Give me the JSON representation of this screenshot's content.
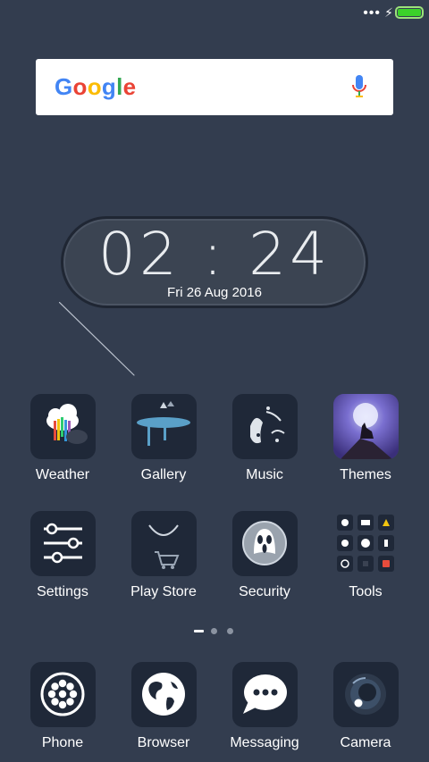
{
  "status_bar": {
    "dots": "•••",
    "charging_icon": "lightning-bolt",
    "battery_level": 1.0,
    "battery_color": "#3bd12a"
  },
  "search": {
    "logo": [
      "G",
      "o",
      "o",
      "g",
      "l",
      "e"
    ],
    "logo_colors": [
      "#4285f4",
      "#ea4335",
      "#fbbc05",
      "#4285f4",
      "#34a853",
      "#ea4335"
    ],
    "mic_icon": "mic"
  },
  "clock": {
    "time": "02 : 24",
    "date": "Fri 26 Aug 2016"
  },
  "apps_row1": [
    {
      "label": "Weather",
      "icon": "weather-cloud"
    },
    {
      "label": "Gallery",
      "icon": "gallery-tree"
    },
    {
      "label": "Music",
      "icon": "music-face"
    },
    {
      "label": "Themes",
      "icon": "themes-wolf"
    }
  ],
  "apps_row2": [
    {
      "label": "Settings",
      "icon": "settings-sliders"
    },
    {
      "label": "Play Store",
      "icon": "play-store-bag"
    },
    {
      "label": "Security",
      "icon": "security-ghost"
    },
    {
      "label": "Tools",
      "icon": "tools-grid"
    }
  ],
  "dock": [
    {
      "label": "Phone",
      "icon": "phone-dial"
    },
    {
      "label": "Browser",
      "icon": "browser-globe"
    },
    {
      "label": "Messaging",
      "icon": "messaging-bubble"
    },
    {
      "label": "Camera",
      "icon": "camera-lens"
    }
  ],
  "page_indicator": {
    "pages": 3,
    "current": 1
  }
}
